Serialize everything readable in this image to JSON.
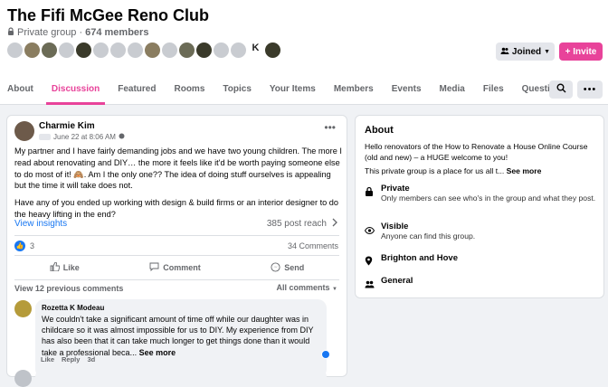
{
  "group": {
    "title": "The Fifi McGee Reno Club",
    "privacy": "Private group",
    "separator": "·",
    "members": "674 members",
    "avatar_letter": "K",
    "joined_label": "Joined",
    "invite_label": "+ Invite"
  },
  "tabs": [
    {
      "label": "About"
    },
    {
      "label": "Discussion"
    },
    {
      "label": "Featured"
    },
    {
      "label": "Rooms"
    },
    {
      "label": "Topics"
    },
    {
      "label": "Your Items"
    },
    {
      "label": "Members"
    },
    {
      "label": "Events"
    },
    {
      "label": "Media"
    },
    {
      "label": "Files"
    },
    {
      "label": "Questions"
    }
  ],
  "active_tab": "Discussion",
  "accent_color": "#e8439a",
  "post": {
    "author": "Charmie Kim",
    "time": "June 22 at 8:06 AM",
    "body_1": "My partner and I have fairly demanding jobs and we have two young children. The more I read about renovating and DIY… the more it feels like it'd be worth paying someone else to do most of it! 🙈. Am I the only one?? The idea of doing stuff ourselves is appealing but the time it will take does not.",
    "body_2": "Have any of you ended up working with design & build firms or an interior designer to do the heavy lifting in the end?",
    "insights": "View insights",
    "reach": "385 post reach",
    "reactions": "3",
    "comments_count": "34 Comments",
    "like": "Like",
    "comment": "Comment",
    "send": "Send",
    "view_previous": "View 12 previous comments",
    "all_comments": "All comments"
  },
  "comment": {
    "author": "Rozetta K Modeau",
    "text": "We couldn't take a significant amount of time off while our daughter was in childcare so it was almost impossible for us to DIY. My experience from DIY has also been that it can take much longer to get things done than it would take a professional beca...",
    "see_more": "See more",
    "like": "Like",
    "reply": "Reply",
    "age": "3d"
  },
  "about": {
    "heading": "About",
    "desc": "Hello renovators of the How to Renovate a House Online Course (old and new) – a HUGE welcome to you!",
    "desc2": "This private group is a place for us all t...",
    "see_more": "See more",
    "private_title": "Private",
    "private_sub": "Only members can see who's in the group and what they post.",
    "visible_title": "Visible",
    "visible_sub": "Anyone can find this group.",
    "location": "Brighton and Hove",
    "general": "General"
  }
}
